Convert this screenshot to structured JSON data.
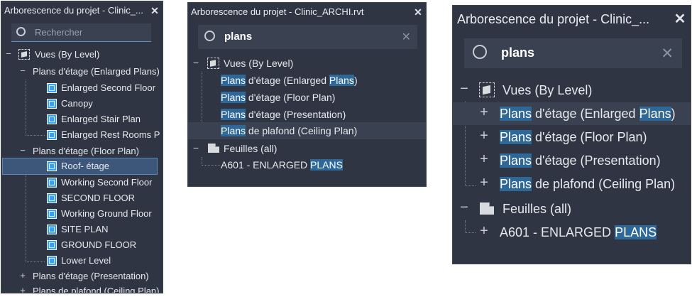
{
  "panels": [
    {
      "title": "Arborescence du projet - Clinic_...",
      "close_glyph": "✕",
      "search": {
        "value": "",
        "placeholder": "Rechercher"
      },
      "rows": [
        {
          "text": "Vues (By Level)",
          "exp": "−"
        },
        {
          "text": "Plans d'étage (Enlarged Plans)",
          "exp": "−"
        },
        {
          "text": "Enlarged Second Floor"
        },
        {
          "text": "Canopy"
        },
        {
          "text": "Enlarged Stair Plan"
        },
        {
          "text": "Enlarged Rest Rooms P"
        },
        {
          "text": "Plans d'étage (Floor Plan)",
          "exp": "−"
        },
        {
          "text": "Roof- étage",
          "selected": true
        },
        {
          "text": "Working Second Floor"
        },
        {
          "text": "SECOND FLOOR"
        },
        {
          "text": "Working Ground Floor"
        },
        {
          "text": "SITE PLAN"
        },
        {
          "text": "GROUND FLOOR"
        },
        {
          "text": "Lower Level"
        },
        {
          "text": "Plans d'étage (Presentation)",
          "exp": "+"
        },
        {
          "text": "Plans de plafond (Ceiling Plan)",
          "exp": "+"
        }
      ]
    },
    {
      "title": "Arborescence du projet - Clinic_ARCHI.rvt",
      "close_glyph": "✕",
      "search": {
        "value": "plans",
        "placeholder": "",
        "clear_glyph": "✕"
      },
      "rows": [
        {
          "text": "Vues (By Level)",
          "exp": "−"
        },
        {
          "pre": "",
          "hit": "Plans",
          "post": " d'étage (Enlarged ",
          "hit2": "Plans",
          "post2": ")"
        },
        {
          "pre": "",
          "hit": "Plans",
          "post": " d'étage (Floor Plan)"
        },
        {
          "pre": "",
          "hit": "Plans",
          "post": " d'étage (Presentation)"
        },
        {
          "pre": "",
          "hit": "Plans",
          "post": " de plafond (Ceiling Plan)",
          "highlight": true
        },
        {
          "text": "Feuilles (all)",
          "exp": "−"
        },
        {
          "pre": "A601 - ENLARGED ",
          "hit": "PLANS",
          "post": ""
        }
      ]
    },
    {
      "title": "Arborescence du projet - Clinic_...",
      "close_glyph": "✕",
      "search": {
        "value": "plans",
        "placeholder": "",
        "clear_glyph": "✕"
      },
      "rows": [
        {
          "text": "Vues (By Level)",
          "exp": "−"
        },
        {
          "pre": "",
          "hit": "Plans",
          "post": " d'étage (Enlarged ",
          "hit2": "Plans",
          "post2": ")",
          "exp": "+",
          "highlight": true
        },
        {
          "pre": "",
          "hit": "Plans",
          "post": " d'étage (Floor Plan)",
          "exp": "+"
        },
        {
          "pre": "",
          "hit": "Plans",
          "post": " d'étage (Presentation)",
          "exp": "+"
        },
        {
          "pre": "",
          "hit": "Plans",
          "post": " de plafond (Ceiling Plan)",
          "exp": "+"
        },
        {
          "text": "Feuilles (all)",
          "exp": "−"
        },
        {
          "pre": "A601 - ENLARGED ",
          "hit": "PLANS",
          "post": "",
          "exp": "+"
        }
      ]
    }
  ],
  "colors": {
    "panel_bg": "#2f3542",
    "search_bg": "#3a4150",
    "match_highlight": "#2d6898",
    "selection": "#3c577a",
    "plan_icon": "#3aa0f0"
  },
  "icons": [
    "search-icon",
    "close-icon",
    "views-icon",
    "sheets-icon",
    "floor-plan-icon",
    "collapse-icon",
    "expand-icon",
    "clear-search-icon"
  ]
}
